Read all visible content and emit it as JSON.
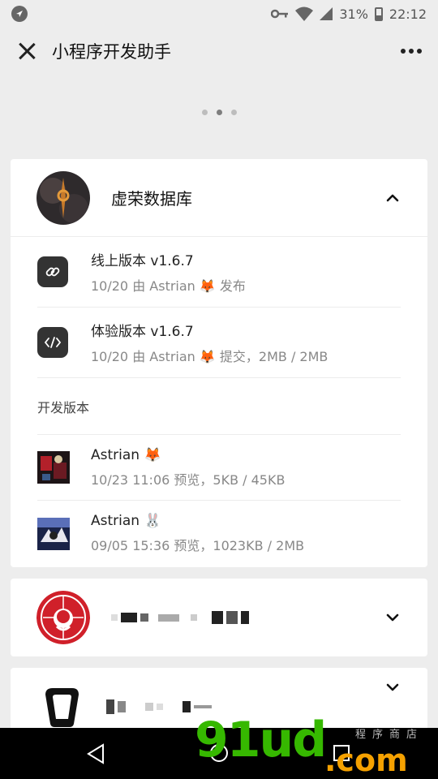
{
  "status_bar": {
    "battery": "31%",
    "time": "22:12"
  },
  "header": {
    "title": "小程序开发助手"
  },
  "carousel": {
    "pages": 3,
    "active_index": 1
  },
  "apps": [
    {
      "name": "虚荣数据库",
      "expanded": true,
      "versions": [
        {
          "title": "线上版本 v1.6.7",
          "subtitle": "10/20 由 Astrian 🦊 发布",
          "icon": "link-icon"
        },
        {
          "title": "体验版本 v1.6.7",
          "subtitle": "10/20 由 Astrian 🦊 提交，2MB / 2MB",
          "icon": "code-icon"
        }
      ],
      "dev_label": "开发版本",
      "dev_versions": [
        {
          "author": "Astrian 🦊",
          "subtitle": "10/23 11:06 预览，5KB / 45KB"
        },
        {
          "author": "Astrian 🐰",
          "subtitle": "09/05 15:36 预览，1023KB / 2MB"
        }
      ]
    },
    {
      "name": "",
      "expanded": false
    },
    {
      "name": "",
      "expanded": false
    }
  ],
  "watermark": {
    "main": "91ud",
    "suffix": ".com",
    "cn": "程序商店"
  },
  "colors": {
    "accent_green": "#36b800",
    "accent_orange": "#f5a100",
    "red_logo": "#d0202a"
  }
}
